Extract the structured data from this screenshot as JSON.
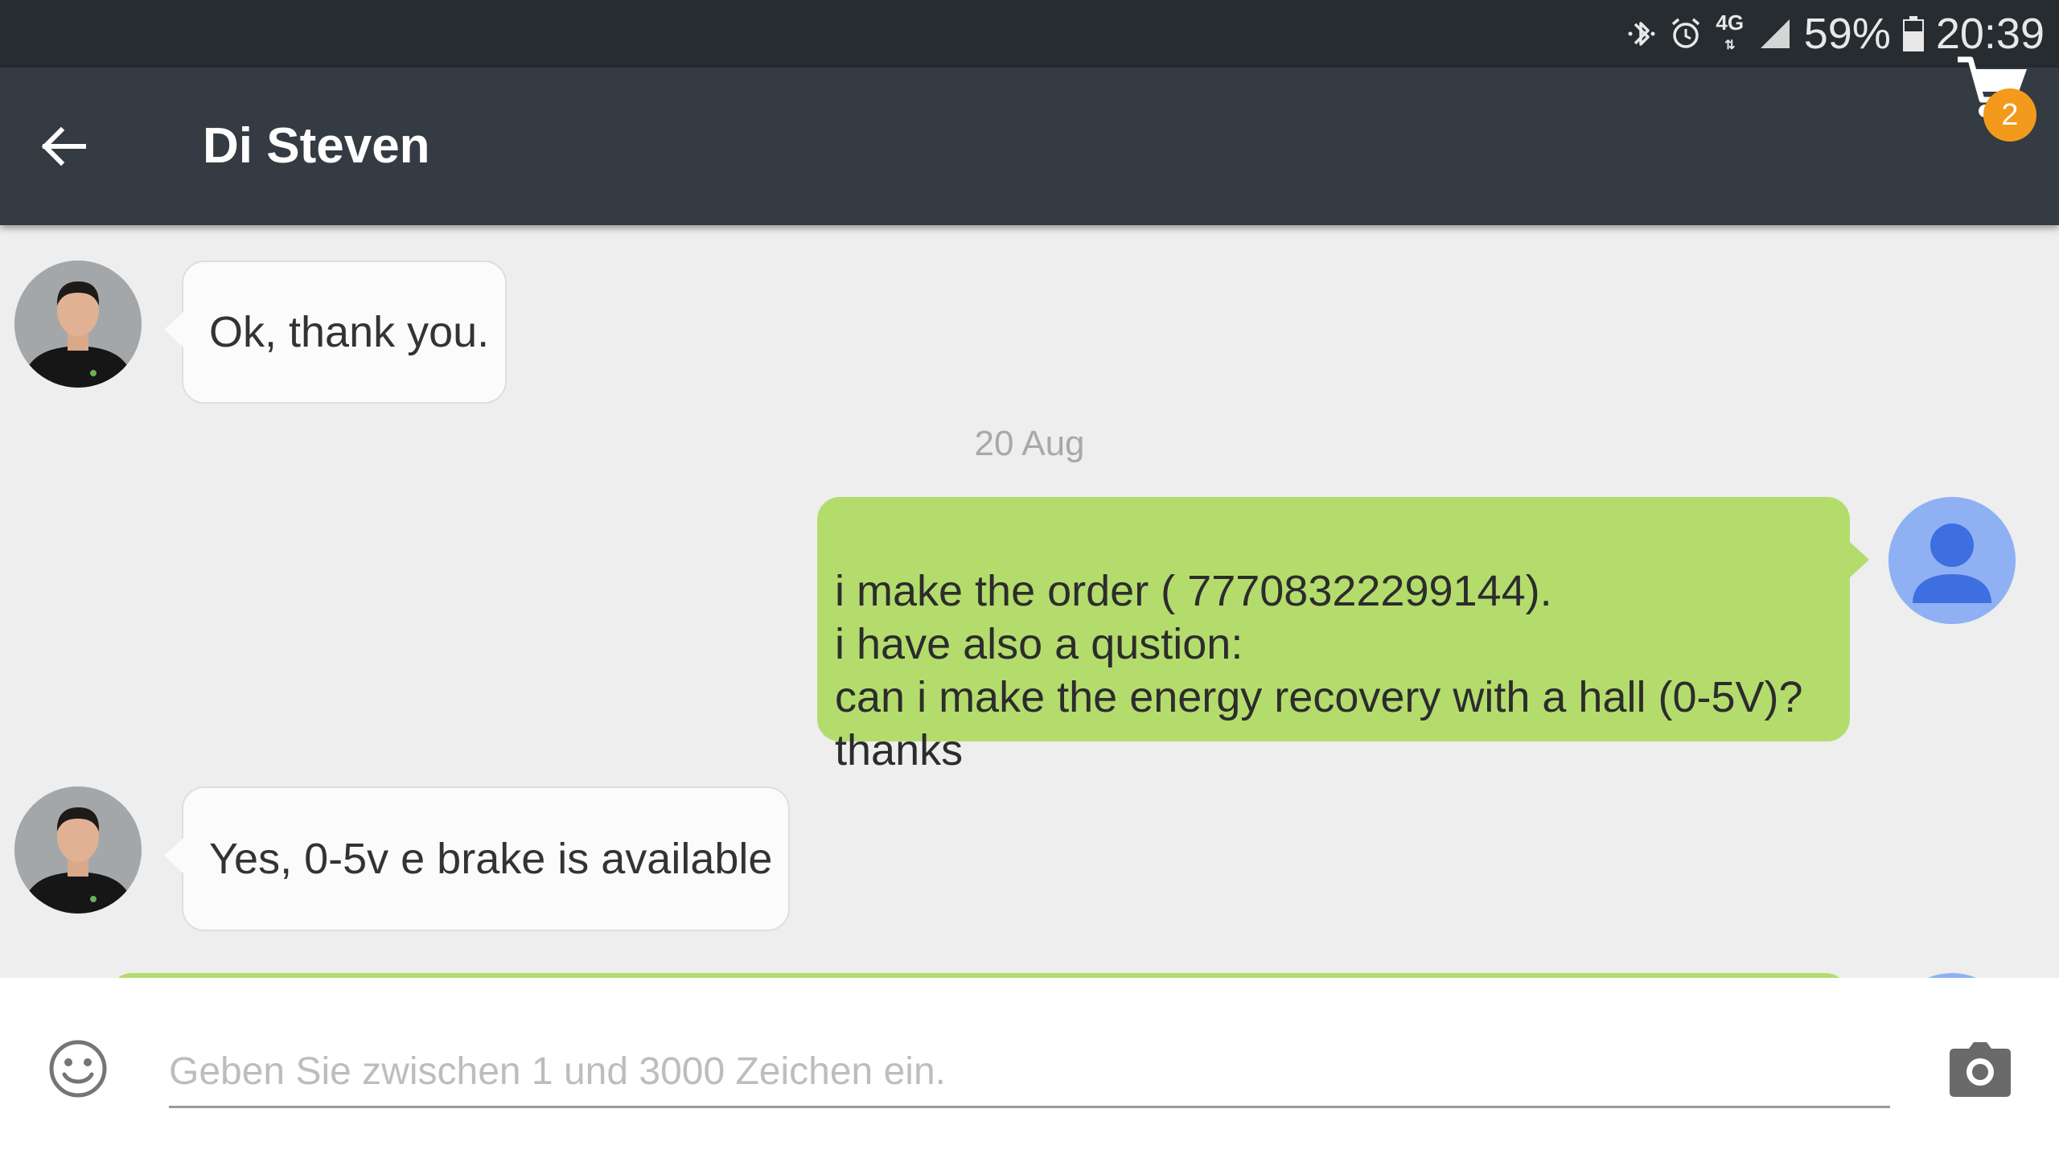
{
  "status_bar": {
    "icons": [
      "bluetooth-icon",
      "alarm-icon",
      "network-4g-icon",
      "signal-icon",
      "battery-icon"
    ],
    "network_label": "4G",
    "battery_percent": "59%",
    "time": "20:39"
  },
  "app_bar": {
    "title": "Di Steven",
    "back_icon": "arrow-left-icon",
    "cart_icon": "cart-icon",
    "cart_badge": "2",
    "badge_color": "#f39a1c",
    "bar_color": "#343b42"
  },
  "messages": [
    {
      "direction": "incoming",
      "text": "Ok, thank you."
    },
    {
      "type": "date",
      "text": "20 Aug"
    },
    {
      "direction": "outgoing",
      "text": "i make the order ( 77708322299144).\ni have also a qustion:\ncan i make the  energy recovery with a hall (0-5V)?\nthanks"
    },
    {
      "direction": "incoming",
      "text": "Yes, 0-5v e brake is available"
    }
  ],
  "colors": {
    "outgoing_bubble": "#b4dc6d",
    "incoming_bubble": "#fbfbfb",
    "background": "#eeeeee"
  },
  "composer": {
    "placeholder": "Geben Sie zwischen 1 und 3000 Zeichen ein.",
    "emoji_icon": "emoji-icon",
    "camera_icon": "camera-icon"
  }
}
